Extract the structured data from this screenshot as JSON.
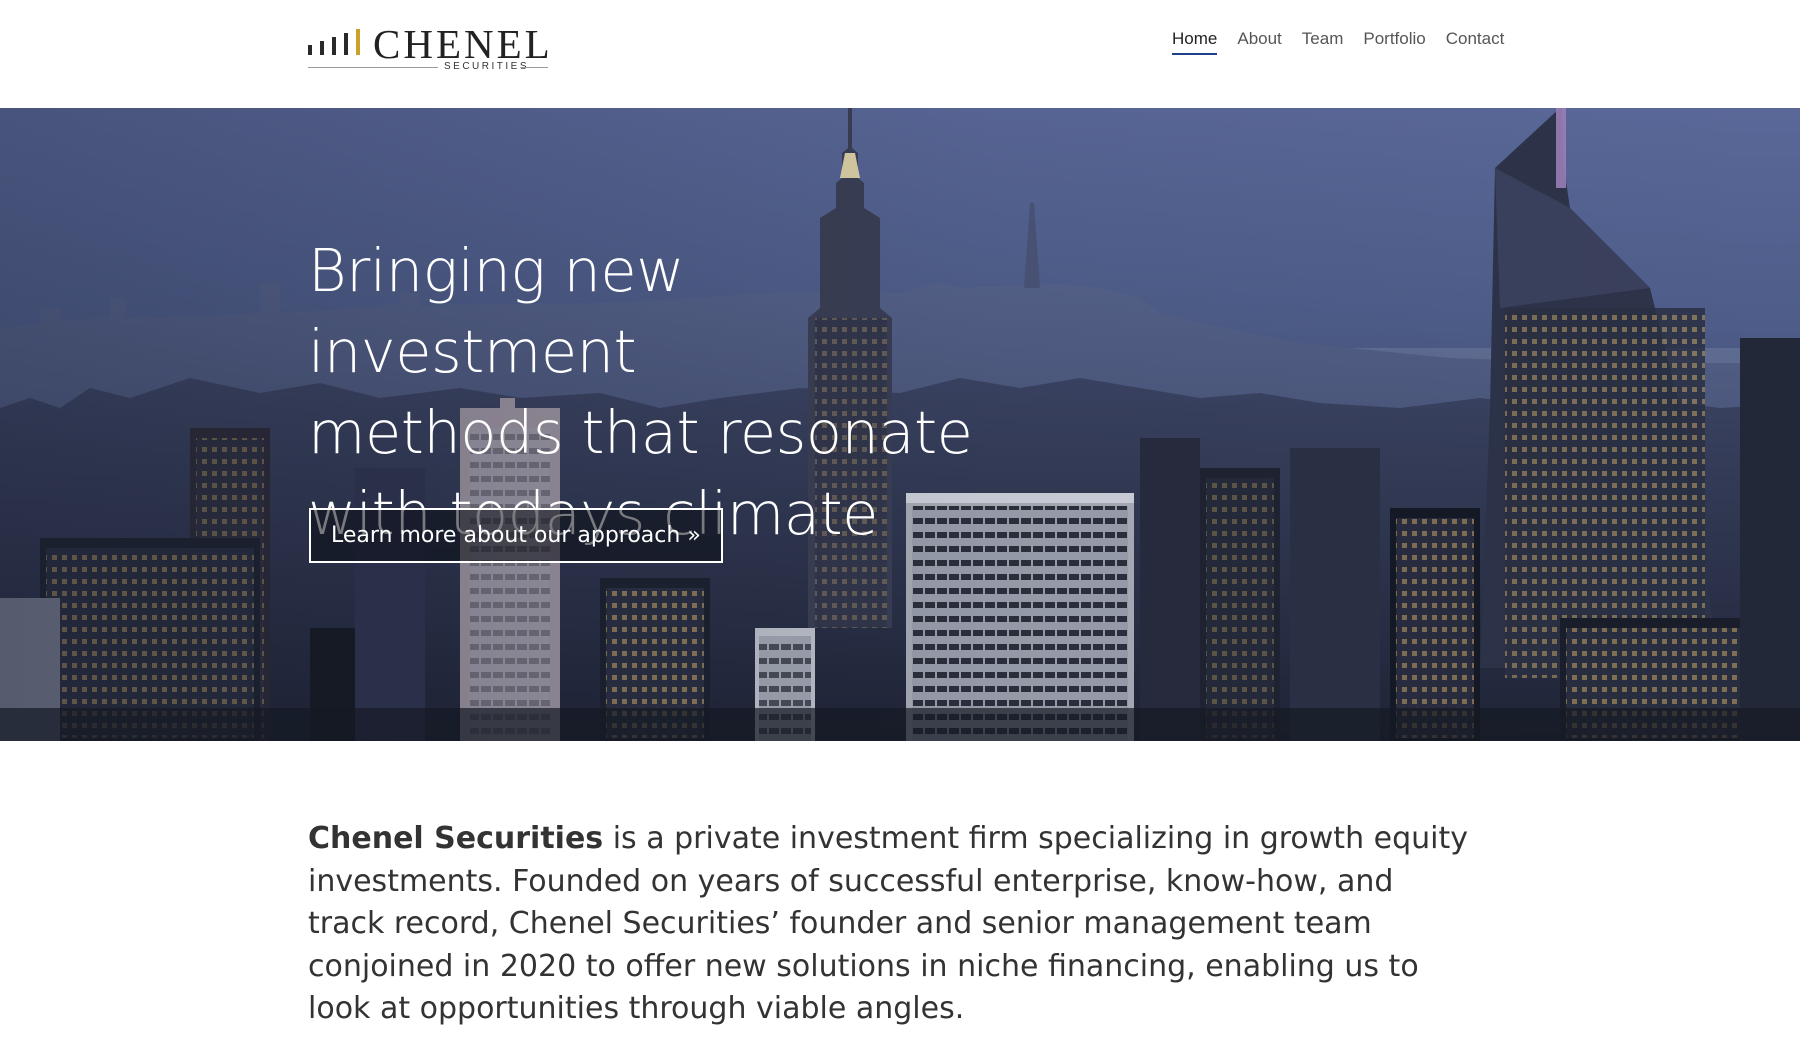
{
  "brand": {
    "name": "CHENEL",
    "tagline": "SECURITIES",
    "accent_color": "#c9a227",
    "nav_active_color": "#1f3f8a"
  },
  "nav": {
    "items": [
      {
        "label": "Home",
        "active": true
      },
      {
        "label": "About",
        "active": false
      },
      {
        "label": "Team",
        "active": false
      },
      {
        "label": "Portfolio",
        "active": false
      },
      {
        "label": "Contact",
        "active": false
      }
    ]
  },
  "hero": {
    "title_lines": [
      "Bringing new investment",
      "methods that resonate",
      "with todays climate"
    ],
    "cta_label": "Learn more about our approach »"
  },
  "intro": {
    "company": "Chenel Securities",
    "text": " is a private investment firm specializing in growth equity investments. Founded on years of successful enterprise, know-how, and track record, Chenel Securities’ founder and senior management team conjoined in 2020 to offer new solutions in niche financing, enabling us to look at opportunities through viable angles."
  }
}
